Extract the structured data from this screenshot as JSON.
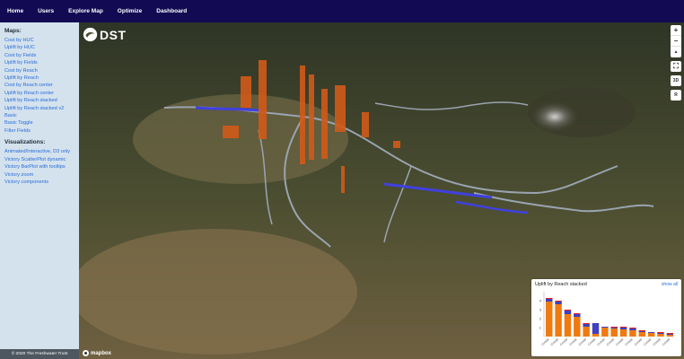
{
  "nav": {
    "items": [
      "Home",
      "Users",
      "Explore Map",
      "Optimize",
      "Dashboard"
    ]
  },
  "sidebar": {
    "maps_heading": "Maps:",
    "maps_links": [
      "Cost by HUC",
      "Uplift by HUC",
      "Cost by Fields",
      "Uplift by Fields",
      "Cost by Reach",
      "Uplift by Reach",
      "Cost by Reach center",
      "Uplift by Reach center",
      "Uplift by Reach stacked",
      "Uplift by Reach stacked v2",
      "Basic",
      "Basic Toggle",
      "Filter Fields"
    ],
    "viz_heading": "Visualizations:",
    "viz_links": [
      "Animated/Interactive, D3 only",
      "Victory ScatterPlot dynamic",
      "Victory BarPlot with tooltips",
      "Victory zoom",
      "Victory components"
    ],
    "footer": "© 2020 The Freshwater Trust"
  },
  "map": {
    "logo_text": "DST",
    "attribution": "mapbox",
    "controls": {
      "zoom_in": "+",
      "zoom_out": "−",
      "compass": "▲",
      "fullscreen": "⛶",
      "toggle_3d": "3D",
      "reset": "R"
    }
  },
  "chart_panel": {
    "title": "Uplift by Reach stacked",
    "show_all": "show all"
  },
  "chart_data": {
    "type": "bar",
    "stacked": true,
    "ylim": [
      0,
      5
    ],
    "yticks": [
      "1",
      "2",
      "3",
      "4"
    ],
    "categories": [
      "Cresap",
      "Cresap",
      "Cresap",
      "Cresap",
      "Cresap",
      "Cresap",
      "Cresap",
      "Cresap",
      "Cresap",
      "Cresap",
      "Cresap",
      "Cresap",
      "Cresap",
      "Cresap"
    ],
    "series": [
      {
        "color": "#f07a10",
        "values": [
          3.9,
          3.6,
          2.5,
          2.2,
          1.1,
          0.3,
          1.0,
          0.9,
          0.8,
          0.7,
          0.5,
          0.4,
          0.3,
          0.2
        ]
      },
      {
        "color": "#4040c0",
        "values": [
          0.3,
          0.3,
          0.4,
          0.3,
          0.3,
          1.2,
          0.1,
          0.1,
          0.2,
          0.2,
          0.1,
          0.1,
          0.1,
          0.1
        ]
      },
      {
        "color": "#e02020",
        "values": [
          0.1,
          0.1,
          0.1,
          0.1,
          0.1,
          0.0,
          0.0,
          0.1,
          0.1,
          0.1,
          0.1,
          0.0,
          0.1,
          0.1
        ]
      }
    ]
  }
}
